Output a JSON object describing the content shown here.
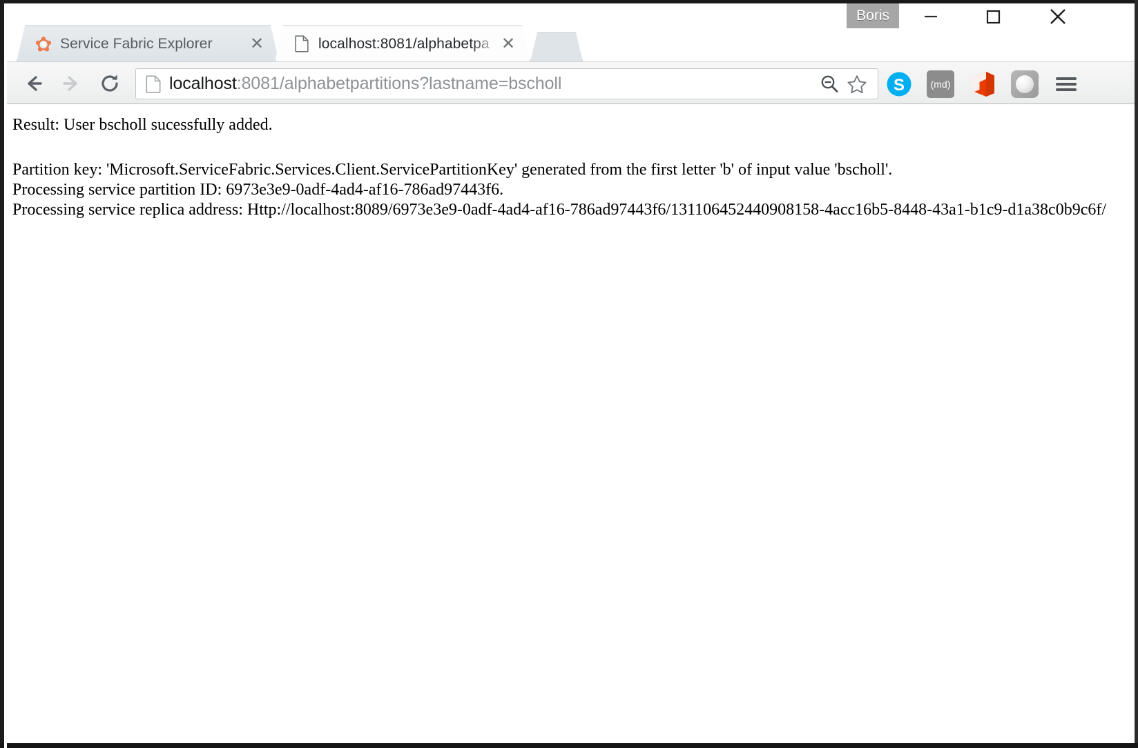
{
  "window": {
    "profile_name": "Boris",
    "controls": {
      "minimize": "minimize-button",
      "maximize": "maximize-button",
      "close": "close-button"
    }
  },
  "tabs": [
    {
      "title": "Service Fabric Explorer",
      "favicon": "service-fabric-icon",
      "close_label": "✕",
      "active": false
    },
    {
      "title": "localhost:8081/alphabetpa",
      "favicon": "page-document-icon",
      "close_label": "✕",
      "active": true
    }
  ],
  "toolbar": {
    "back_icon": "back-arrow-icon",
    "forward_icon": "forward-arrow-icon",
    "reload_icon": "reload-icon",
    "omnibox": {
      "page_icon": "page-document-icon",
      "host": "localhost",
      "rest": ":8081/alphabetpartitions?lastname=bscholl",
      "full_url": "localhost:8081/alphabetpartitions?lastname=bscholl",
      "zoom_out_icon": "zoom-out-icon",
      "bookmark_icon": "bookmark-star-icon"
    },
    "extensions": [
      {
        "name": "skype-extension-icon",
        "label": "S"
      },
      {
        "name": "md-extension-icon",
        "label": "(md)"
      },
      {
        "name": "office-extension-icon",
        "label": ""
      },
      {
        "name": "grayscale-extension-icon",
        "label": ""
      }
    ],
    "menu_icon": "hamburger-menu-icon"
  },
  "page": {
    "result_line": "Result: User bscholl sucessfully added.",
    "partition_key_line": "Partition key: 'Microsoft.ServiceFabric.Services.Client.ServicePartitionKey' generated from the first letter 'b' of input value 'bscholl'.",
    "partition_id_line": "Processing service partition ID: 6973e3e9-0adf-4ad4-af16-786ad97443f6.",
    "replica_address_line": "Processing service replica address: Http://localhost:8089/6973e3e9-0adf-4ad4-af16-786ad97443f6/131106452440908158-4acc16b5-8448-43a1-b1c9-d1a38c0b9c6f/"
  },
  "colors": {
    "skype_blue": "#00aff0",
    "office_orange": "#eb3c00",
    "service_fabric_orange": "#ec7b4f",
    "profile_badge_gray": "#a6a6a6",
    "toolbar_gray": "#eceded"
  }
}
